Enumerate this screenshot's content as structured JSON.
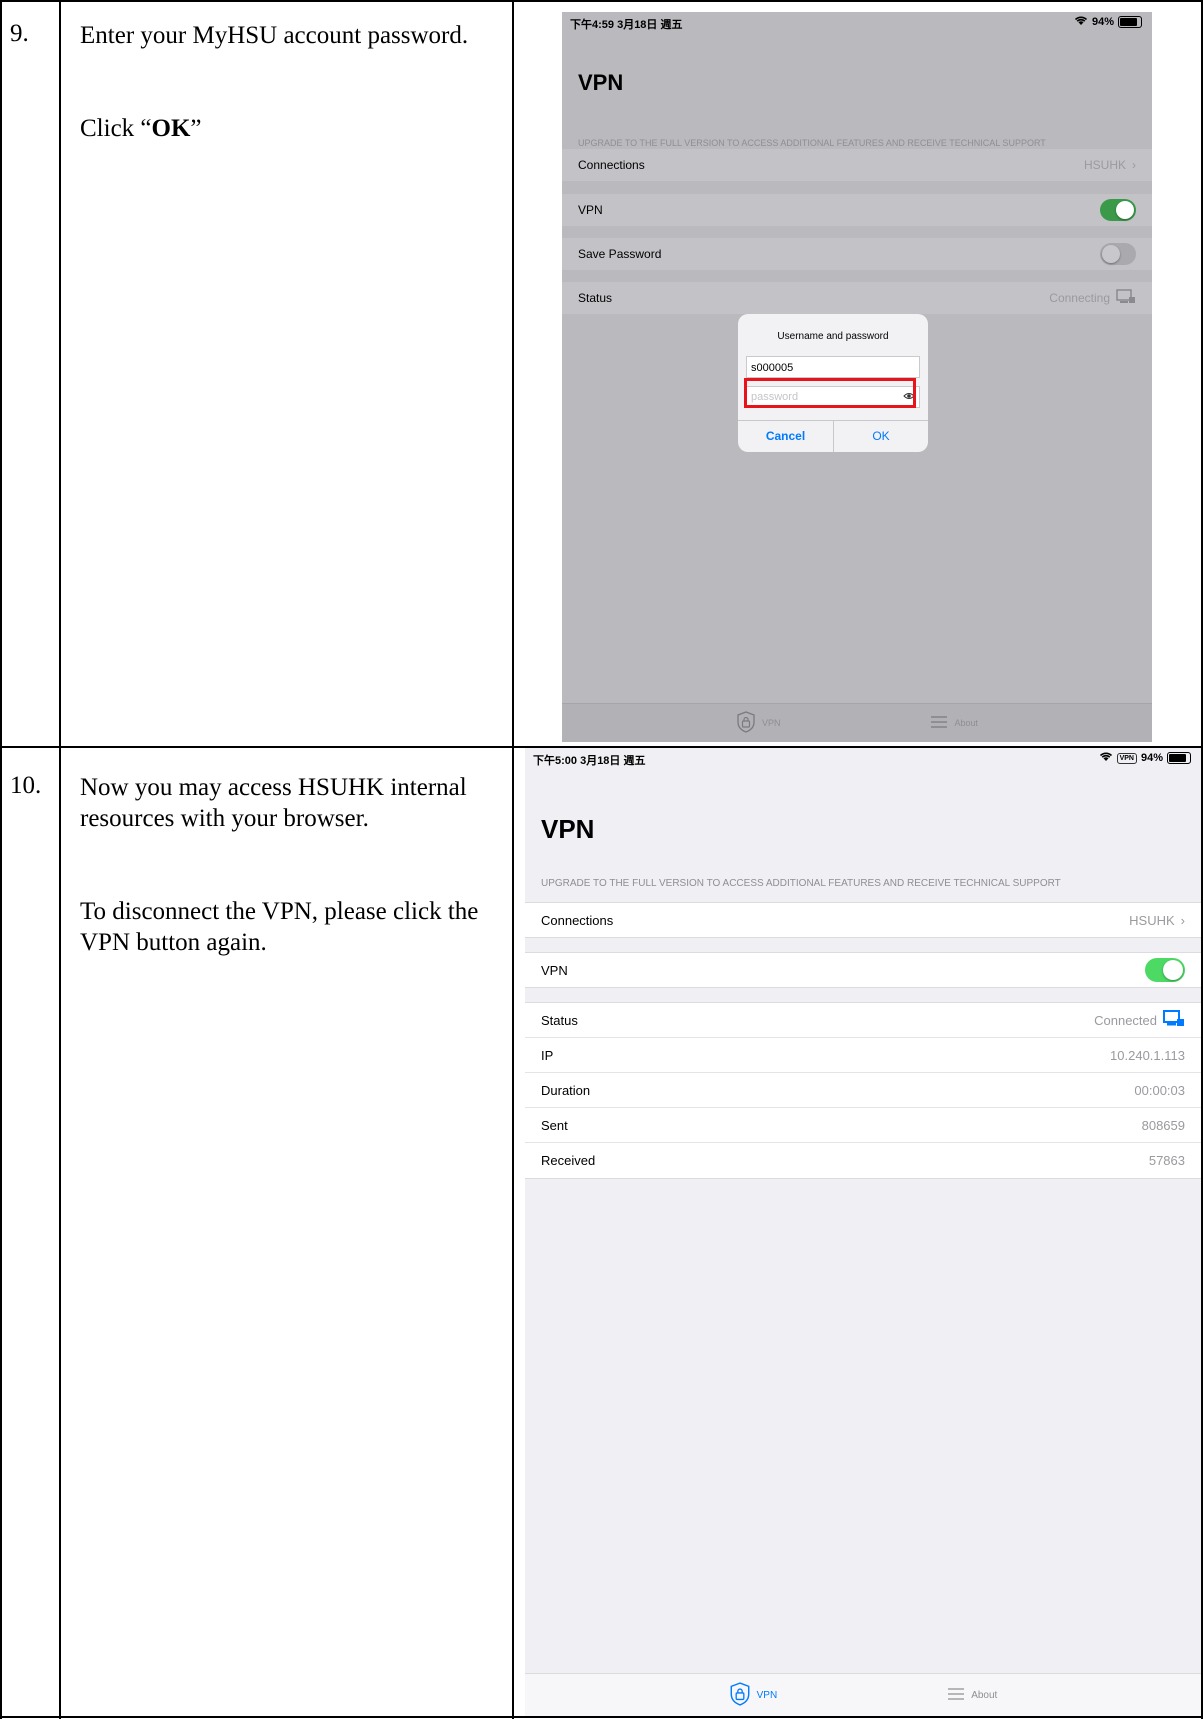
{
  "steps": [
    {
      "number": "9.",
      "instructions": {
        "line1": "Enter your MyHSU account password.",
        "click_prefix": "Click “",
        "click_bold": "OK",
        "click_suffix": "”"
      },
      "screenshot": {
        "status_time": "下午4:59  3月18日 週五",
        "status_battery": "94%",
        "status_battery_level": 0.94,
        "title": "VPN",
        "upgrade_text": "UPGRADE TO THE FULL VERSION TO ACCESS ADDITIONAL FEATURES AND RECEIVE TECHNICAL SUPPORT",
        "rows": {
          "connections_label": "Connections",
          "connections_value": "HSUHK",
          "vpn_label": "VPN",
          "vpn_on": true,
          "save_password_label": "Save Password",
          "save_password_on": false,
          "status_label": "Status",
          "status_value": "Connecting"
        },
        "dialog": {
          "title": "Username and password",
          "username_value": "s000005",
          "password_placeholder": "password",
          "cancel_label": "Cancel",
          "ok_label": "OK"
        },
        "tabbar": {
          "vpn_label": "VPN",
          "about_label": "About"
        }
      }
    },
    {
      "number": "10.",
      "instructions": {
        "line1": "Now you may access HSUHK internal resources with your browser.",
        "line2": "To disconnect the VPN, please click the VPN button again."
      },
      "screenshot": {
        "status_time": "下午5:00  3月18日 週五",
        "status_vpn_badge": "VPN",
        "status_battery": "94%",
        "status_battery_level": 0.94,
        "title": "VPN",
        "upgrade_text": "UPGRADE TO THE FULL VERSION TO ACCESS ADDITIONAL FEATURES AND RECEIVE TECHNICAL SUPPORT",
        "rows": {
          "connections_label": "Connections",
          "connections_value": "HSUHK",
          "vpn_label": "VPN",
          "vpn_on": true,
          "status_label": "Status",
          "status_value": "Connected",
          "ip_label": "IP",
          "ip_value": "10.240.1.113",
          "duration_label": "Duration",
          "duration_value": "00:00:03",
          "sent_label": "Sent",
          "sent_value": "808659",
          "received_label": "Received",
          "received_value": "57863"
        },
        "tabbar": {
          "vpn_label": "VPN",
          "about_label": "About"
        }
      }
    }
  ],
  "colors": {
    "toggle_on": "#4cd964",
    "toggle_off": "#e9e9eb",
    "ios_blue": "#007aff",
    "highlight_red": "#e8141c"
  }
}
